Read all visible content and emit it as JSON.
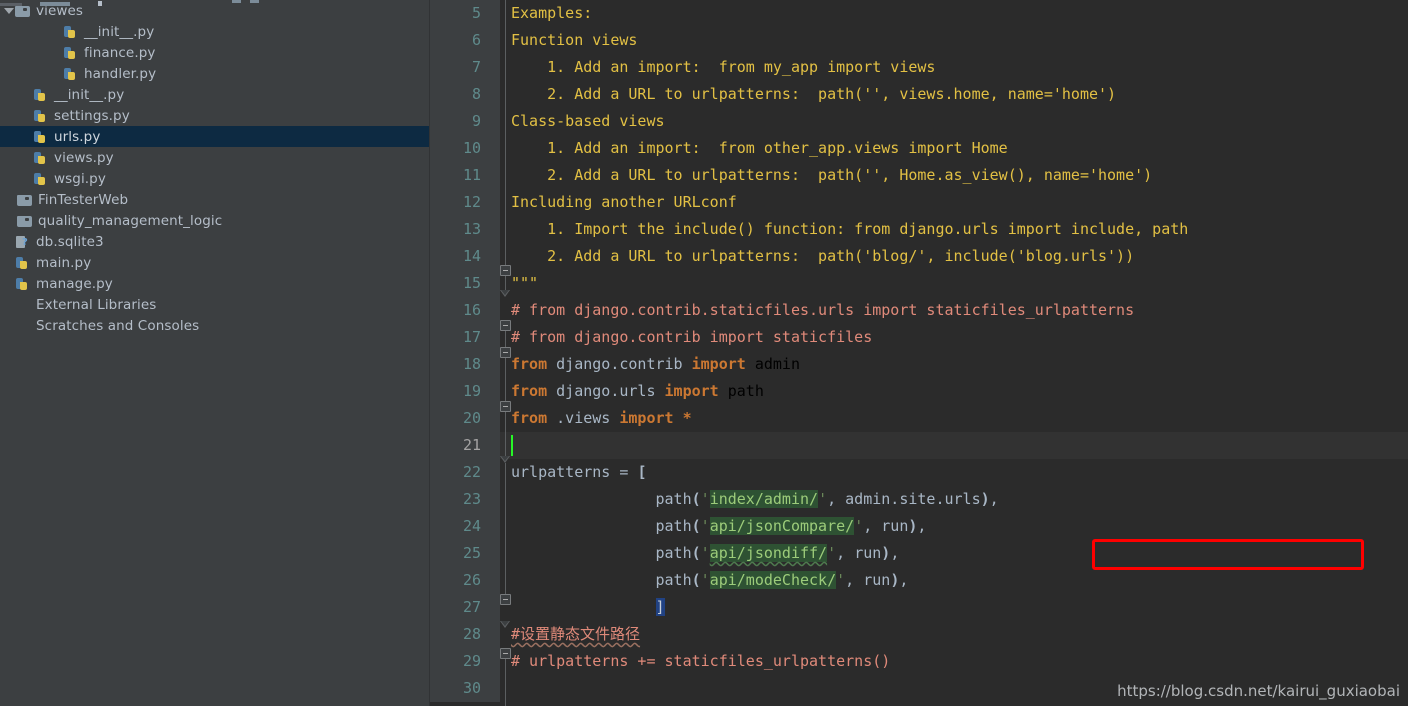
{
  "sidebar": {
    "items": [
      {
        "label": "viewes",
        "icon": "folder-icon",
        "indent": 0,
        "arrow": "down",
        "selected": false,
        "type": "folder"
      },
      {
        "label": "__init__.py",
        "icon": "python-file-icon",
        "indent": 48,
        "arrow": "none",
        "selected": false,
        "type": "py"
      },
      {
        "label": "finance.py",
        "icon": "python-file-icon",
        "indent": 48,
        "arrow": "none",
        "selected": false,
        "type": "py"
      },
      {
        "label": "handler.py",
        "icon": "python-file-icon",
        "indent": 48,
        "arrow": "none",
        "selected": false,
        "type": "py"
      },
      {
        "label": "__init__.py",
        "icon": "python-file-icon",
        "indent": 18,
        "arrow": "none",
        "selected": false,
        "type": "py"
      },
      {
        "label": "settings.py",
        "icon": "python-file-icon",
        "indent": 18,
        "arrow": "none",
        "selected": false,
        "type": "py"
      },
      {
        "label": "urls.py",
        "icon": "python-file-icon",
        "indent": 18,
        "arrow": "none",
        "selected": true,
        "type": "py"
      },
      {
        "label": "views.py",
        "icon": "python-file-icon",
        "indent": 18,
        "arrow": "none",
        "selected": false,
        "type": "py"
      },
      {
        "label": "wsgi.py",
        "icon": "python-file-icon",
        "indent": 18,
        "arrow": "none",
        "selected": false,
        "type": "py"
      },
      {
        "label": "FinTesterWeb",
        "icon": "folder-icon",
        "indent": 2,
        "arrow": "none",
        "selected": false,
        "type": "folder"
      },
      {
        "label": "quality_management_logic",
        "icon": "folder-icon",
        "indent": 2,
        "arrow": "none",
        "selected": false,
        "type": "folder"
      },
      {
        "label": "db.sqlite3",
        "icon": "database-file-icon",
        "indent": 0,
        "arrow": "none",
        "selected": false,
        "type": "db"
      },
      {
        "label": "main.py",
        "icon": "python-file-icon",
        "indent": 0,
        "arrow": "none",
        "selected": false,
        "type": "py"
      },
      {
        "label": "manage.py",
        "icon": "python-file-icon",
        "indent": 0,
        "arrow": "none",
        "selected": false,
        "type": "py"
      },
      {
        "label": "External Libraries",
        "icon": "none",
        "indent": 0,
        "arrow": "none",
        "selected": false,
        "type": "none"
      },
      {
        "label": "Scratches and Consoles",
        "icon": "none",
        "indent": 0,
        "arrow": "none",
        "selected": false,
        "type": "none"
      }
    ]
  },
  "editor": {
    "current_line": 21,
    "first_line_number": 5,
    "last_line_number": 30,
    "lines": [
      {
        "n": 5,
        "text": "Examples:"
      },
      {
        "n": 6,
        "text": "Function views"
      },
      {
        "n": 7,
        "text": "    1. Add an import:  from my_app import views"
      },
      {
        "n": 8,
        "text": "    2. Add a URL to urlpatterns:  path('', views.home, name='home')"
      },
      {
        "n": 9,
        "text": "Class-based views"
      },
      {
        "n": 10,
        "text": "    1. Add an import:  from other_app.views import Home"
      },
      {
        "n": 11,
        "text": "    2. Add a URL to urlpatterns:  path('', Home.as_view(), name='home')"
      },
      {
        "n": 12,
        "text": "Including another URLconf"
      },
      {
        "n": 13,
        "text": "    1. Import the include() function: from django.urls import include, path"
      },
      {
        "n": 14,
        "text": "    2. Add a URL to urlpatterns:  path('blog/', include('blog.urls'))"
      },
      {
        "n": 15,
        "text": "\"\"\""
      },
      {
        "n": 16,
        "text": "# from django.contrib.staticfiles.urls import staticfiles_urlpatterns"
      },
      {
        "n": 17,
        "text": "# from django.contrib import staticfiles"
      },
      {
        "n": 18,
        "text": "from django.contrib import admin"
      },
      {
        "n": 19,
        "text": "from django.urls import path"
      },
      {
        "n": 20,
        "text": "from .views import *"
      },
      {
        "n": 21,
        "text": ""
      },
      {
        "n": 22,
        "text": "urlpatterns = ["
      },
      {
        "n": 23,
        "text": "                path('index/admin/', admin.site.urls),"
      },
      {
        "n": 24,
        "text": "                path('api/jsonCompare/', run),"
      },
      {
        "n": 25,
        "text": "                path('api/jsondiff/', run),"
      },
      {
        "n": 26,
        "text": "                path('api/modeCheck/', run),"
      },
      {
        "n": 27,
        "text": "                ]"
      },
      {
        "n": 28,
        "text": "#设置静态文件路径"
      },
      {
        "n": 29,
        "text": "# urlpatterns += staticfiles_urlpatterns()"
      },
      {
        "n": 30,
        "text": ""
      }
    ],
    "annotation": {
      "type": "red-rectangle",
      "around_line": 25
    }
  },
  "watermark": {
    "text": "https://blog.csdn.net/kairui_guxiaobai"
  },
  "colors": {
    "sidebar_bg": "#3c3f41",
    "editor_bg": "#2b2b2b",
    "current_line_bg": "#323232",
    "selection_bg": "#0d2a42",
    "docstring": "#e2c044",
    "comment": "#e08a7a",
    "keyword": "#cc7832",
    "identifier": "#a9b7c6",
    "string": "#6a8759",
    "string_highlight_bg": "#2e5233",
    "string_highlight_fg": "#9ccc7a",
    "caret": "#27f727",
    "annotation": "#ff0000"
  }
}
